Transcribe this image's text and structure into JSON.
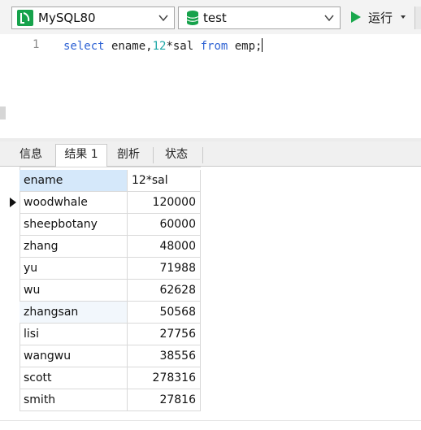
{
  "toolbar": {
    "connection": "MySQL80",
    "database": "test",
    "run_label": "运行"
  },
  "editor": {
    "line_number": "1",
    "code": {
      "kw_select": "select",
      "part1": " ename,",
      "num": "12",
      "part2": "*sal ",
      "kw_from": "from",
      "part3": " emp;"
    }
  },
  "tabs": [
    "信息",
    "结果 1",
    "剖析",
    "状态"
  ],
  "active_tab": 1,
  "grid": {
    "columns": [
      "ename",
      "12*sal"
    ],
    "rows": [
      [
        "woodwhale",
        "120000"
      ],
      [
        "sheepbotany",
        "60000"
      ],
      [
        "zhang",
        "48000"
      ],
      [
        "yu",
        "71988"
      ],
      [
        "wu",
        "62628"
      ],
      [
        "zhangsan",
        "50568"
      ],
      [
        "lisi",
        "27756"
      ],
      [
        "wangwu",
        "38556"
      ],
      [
        "scott",
        "278316"
      ],
      [
        "smith",
        "27816"
      ]
    ],
    "selected_row": 0
  },
  "colors": {
    "accent_green": "#16a24b",
    "keyword_blue": "#2f63d4",
    "number_teal": "#1ea7a7",
    "header_highlight": "#d5e8fa"
  },
  "icons": [
    "connection-icon",
    "database-icon",
    "chevron-down-icon",
    "play-icon",
    "row-indicator-icon"
  ]
}
